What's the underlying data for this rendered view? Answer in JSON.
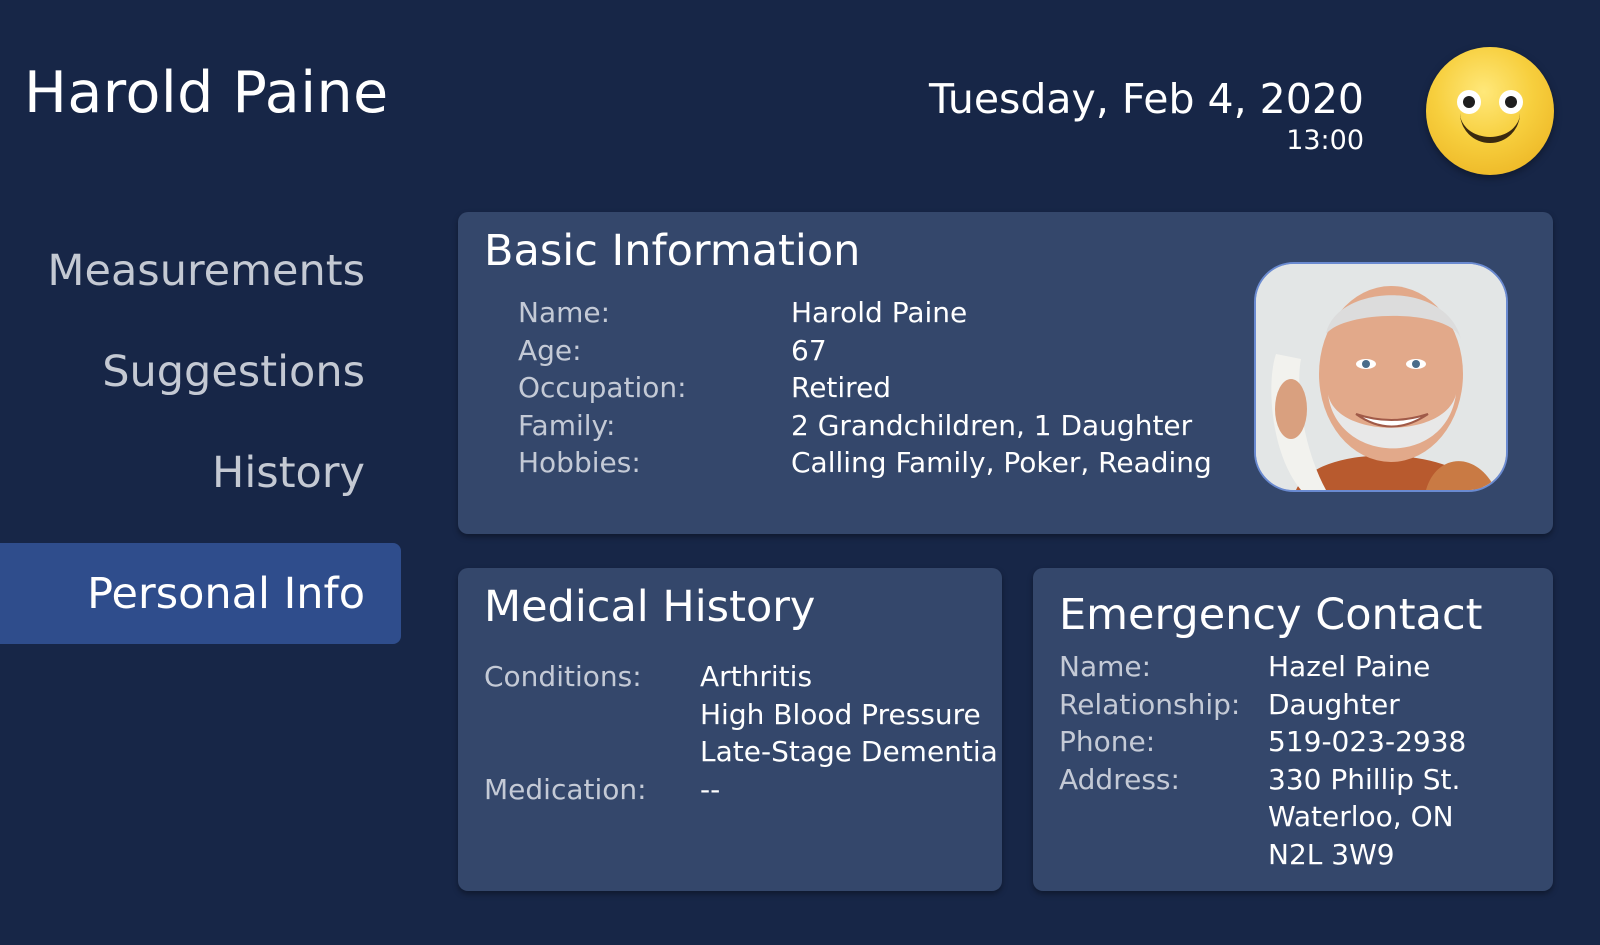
{
  "header": {
    "patient_name": "Harold Paine",
    "date": "Tuesday, Feb 4, 2020",
    "time": "13:00"
  },
  "nav": {
    "items": [
      {
        "label": "Measurements"
      },
      {
        "label": "Suggestions"
      },
      {
        "label": "History"
      },
      {
        "label": "Personal Info",
        "active": true
      }
    ]
  },
  "basic": {
    "title": "Basic Information",
    "fields": [
      {
        "label": "Name:",
        "value": "Harold Paine"
      },
      {
        "label": "Age:",
        "value": "67"
      },
      {
        "label": "Occupation:",
        "value": "Retired"
      },
      {
        "label": "Family:",
        "value": "2 Grandchildren, 1 Daughter"
      },
      {
        "label": "Hobbies:",
        "value": "Calling Family, Poker, Reading"
      }
    ]
  },
  "medical": {
    "title": "Medical History",
    "conditions_label": "Conditions:",
    "conditions": [
      "Arthritis",
      "High Blood Pressure",
      "Late-Stage Dementia"
    ],
    "medication_label": "Medication:",
    "medication": "--"
  },
  "emergency": {
    "title": "Emergency Contact",
    "name_label": "Name:",
    "name": "Hazel Paine",
    "relationship_label": "Relationship:",
    "relationship": "Daughter",
    "phone_label": "Phone:",
    "phone": "519-023-2938",
    "address_label": "Address:",
    "address": [
      "330 Phillip St.",
      "Waterloo, ON",
      "N2L 3W9"
    ]
  },
  "colors": {
    "background": "#172647",
    "card": "#34476b",
    "nav_active": "#2f4d8c"
  }
}
